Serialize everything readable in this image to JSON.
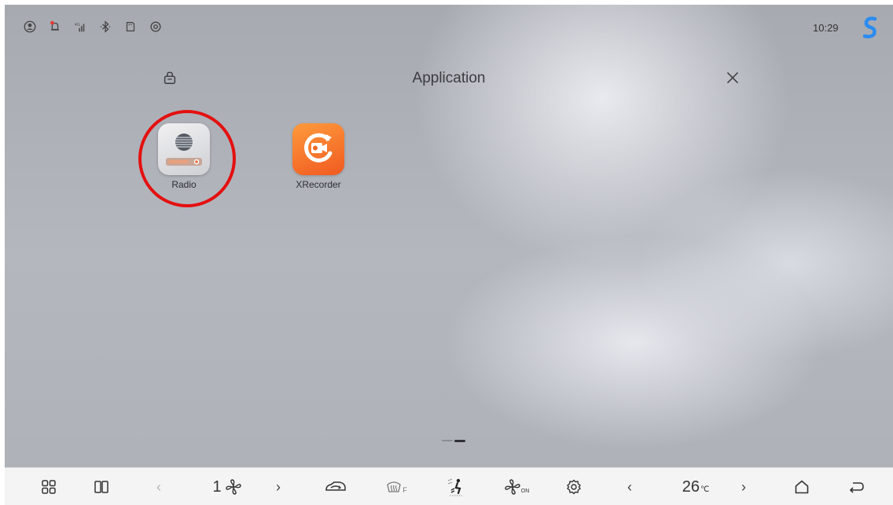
{
  "status_bar": {
    "icons": [
      "account-icon",
      "notification-icon",
      "signal-icon",
      "bluetooth-icon",
      "sd-card-icon",
      "location-icon"
    ],
    "signal_label": "4G",
    "time": "10:29",
    "notification_color": "#e53935"
  },
  "header": {
    "title": "Application"
  },
  "apps": [
    {
      "label": "Radio",
      "icon": "radio-icon",
      "highlighted": true
    },
    {
      "label": "XRecorder",
      "icon": "xrecorder-icon",
      "highlighted": false
    }
  ],
  "highlight_color": "#e41010",
  "bottom_bar": {
    "fan_level": "1",
    "temperature": "26",
    "temperature_unit": "℃",
    "defrost_label": "F",
    "fan_on_label": "ON",
    "items": [
      "apps-grid-icon",
      "split-screen-icon",
      "fan-decrease-arrow",
      "fan-speed",
      "fan-increase-arrow",
      "car-air-circulation-icon",
      "front-defrost-icon",
      "airflow-mode-icon",
      "fan-on-icon",
      "climate-settings-icon",
      "temp-decrease-arrow",
      "temperature",
      "temp-increase-arrow",
      "home-icon",
      "back-icon"
    ]
  }
}
